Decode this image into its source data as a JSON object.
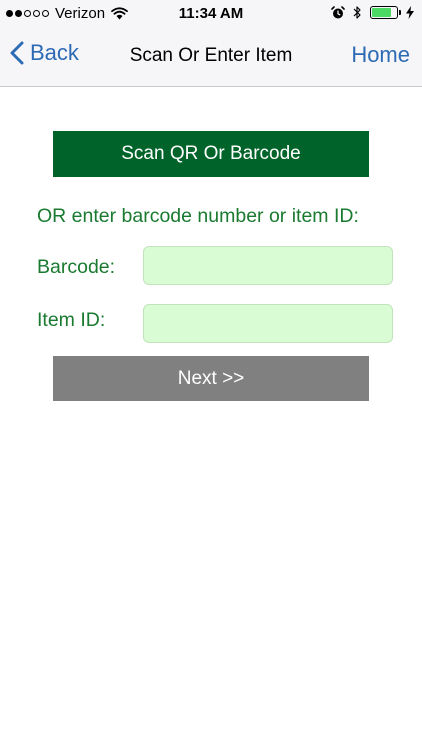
{
  "status_bar": {
    "carrier": "Verizon",
    "time": "11:34 AM",
    "signal_bars_filled": 2,
    "signal_bars_total": 5,
    "battery_level": 0.8,
    "battery_color": "#4cd964"
  },
  "nav": {
    "back_label": "Back",
    "title": "Scan Or Enter Item",
    "home_label": "Home",
    "accent_color": "#2d6ab4"
  },
  "scan": {
    "button_label": "Scan QR Or Barcode",
    "button_color": "#00642a"
  },
  "form": {
    "instruction": "OR enter barcode number or item ID:",
    "barcode_label": "Barcode:",
    "barcode_value": "",
    "item_id_label": "Item ID:",
    "item_id_value": "",
    "label_color": "#1a7a30",
    "field_color": "#d9fcd4"
  },
  "next": {
    "button_label": "Next >>",
    "button_color": "#808080"
  },
  "icons": {
    "back": "chevron-left-icon",
    "wifi": "wifi-icon",
    "alarm": "alarm-clock-icon",
    "bluetooth": "bluetooth-icon",
    "battery": "battery-icon",
    "charging": "charging-bolt-icon"
  }
}
